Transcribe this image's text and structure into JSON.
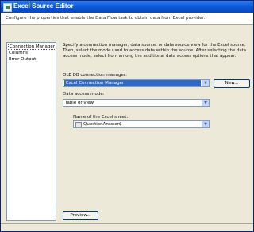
{
  "window": {
    "title": "Excel Source Editor",
    "description": "Configure the properties that enable the Data Flow task to obtain data from Excel provider."
  },
  "sidebar": {
    "items": [
      {
        "label": "Connection Manager"
      },
      {
        "label": "Columns"
      },
      {
        "label": "Error Output"
      }
    ]
  },
  "main": {
    "description": "Specify a connection manager, data source, or data source view for the Excel source. Then, select the mode used to access data within the source. After selecting the data access mode, select from among the additional data access options that appear.",
    "connection_label": "OLE DB connection manager:",
    "connection_value": "Excel Connection Manager",
    "new_button": "New...",
    "mode_label": "Data access mode:",
    "mode_value": "Table or view",
    "sheet_label": "Name of the Excel sheet:",
    "sheet_value": "QuestionAnswer$",
    "preview_button": "Preview..."
  }
}
